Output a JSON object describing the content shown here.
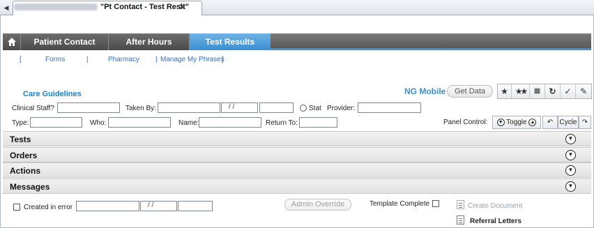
{
  "window": {
    "tab_title": "\"Pt Contact - Test Reslt\"",
    "tab_close": "✕",
    "tab_scroll_arrow": "◀"
  },
  "nav": {
    "home_icon": "home-icon",
    "tabs": [
      "Patient Contact",
      "After Hours",
      "Test Results"
    ],
    "active_tab": "Test Results"
  },
  "sublinks": [
    "Forms",
    "Pharmacy",
    "Manage My Phrases"
  ],
  "care_guidelines": "Care Guidelines",
  "ng_mobile": {
    "label": "NG Mobile",
    "get_data": "Get Data"
  },
  "toolbar_icons": [
    "star-icon",
    "double-star-icon",
    "calculator-icon",
    "refresh-icon",
    "clipboard-check-icon",
    "eraser-icon"
  ],
  "form": {
    "clinical_staff_label": "Clinical Staff?",
    "taken_by_label": "Taken By:",
    "date_placeholder": "/ /",
    "stat_label": "Stat",
    "provider_label": "Provider:",
    "type_label": "Type:",
    "who_label": "Who:",
    "name_label": "Name:",
    "return_to_label": "Return To:"
  },
  "panel_control": {
    "label": "Panel Control:",
    "toggle": "Toggle",
    "cycle": "Cycle"
  },
  "sections": [
    "Tests",
    "Orders",
    "Actions",
    "Messages"
  ],
  "bottom": {
    "created_in_error": "Created in error",
    "date_placeholder": "/ /",
    "admin_override": "Admin Override",
    "template_complete": "Template Complete",
    "create_document": "Create Document",
    "referral_letters": "Referral Letters"
  },
  "colors": {
    "accent": "#3b8fd1",
    "link": "#2f6fc5",
    "nav_dark": "#5a5a5a"
  }
}
